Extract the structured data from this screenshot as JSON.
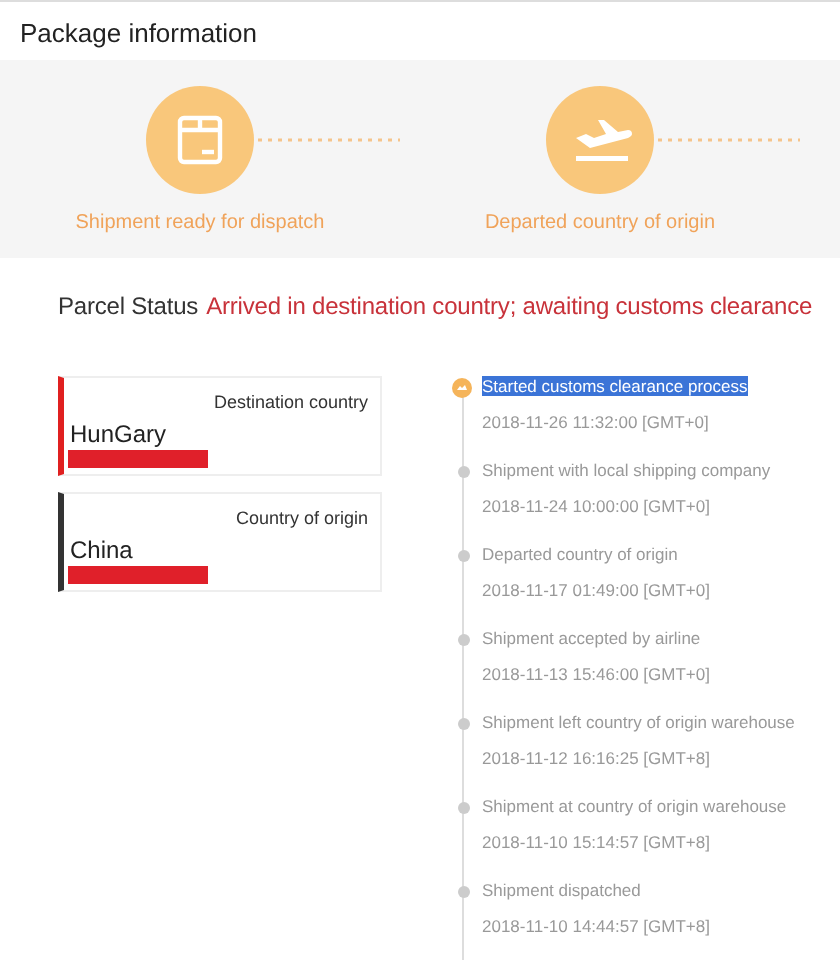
{
  "header": {
    "title": "Package information"
  },
  "progress": [
    {
      "kind": "box",
      "label": "Shipment ready for dispatch"
    },
    {
      "kind": "plane",
      "label": "Departed country of origin"
    }
  ],
  "parcel_status": {
    "label": "Parcel Status",
    "value": "Arrived in destination country; awaiting customs clearance"
  },
  "countries": [
    {
      "caption": "Destination country",
      "name": "HunGary",
      "color": "#e02020"
    },
    {
      "caption": "Country of origin",
      "name": "China",
      "color": "#333333"
    }
  ],
  "events": [
    {
      "title": "Started customs clearance process",
      "time": "2018-11-26 11:32:00 [GMT+0]",
      "current": true,
      "highlighted": true
    },
    {
      "title": "Shipment with local shipping company",
      "time": "2018-11-24 10:00:00 [GMT+0]",
      "current": false,
      "highlighted": false
    },
    {
      "title": "Departed country of origin",
      "time": "2018-11-17 01:49:00 [GMT+0]",
      "current": false,
      "highlighted": false
    },
    {
      "title": "Shipment accepted by airline",
      "time": "2018-11-13 15:46:00 [GMT+0]",
      "current": false,
      "highlighted": false
    },
    {
      "title": "Shipment left country of origin warehouse",
      "time": "2018-11-12 16:16:25 [GMT+8]",
      "current": false,
      "highlighted": false
    },
    {
      "title": "Shipment at country of origin warehouse",
      "time": "2018-11-10 15:14:57 [GMT+8]",
      "current": false,
      "highlighted": false
    },
    {
      "title": "Shipment dispatched",
      "time": "2018-11-10 14:44:57 [GMT+8]",
      "current": false,
      "highlighted": false
    }
  ]
}
